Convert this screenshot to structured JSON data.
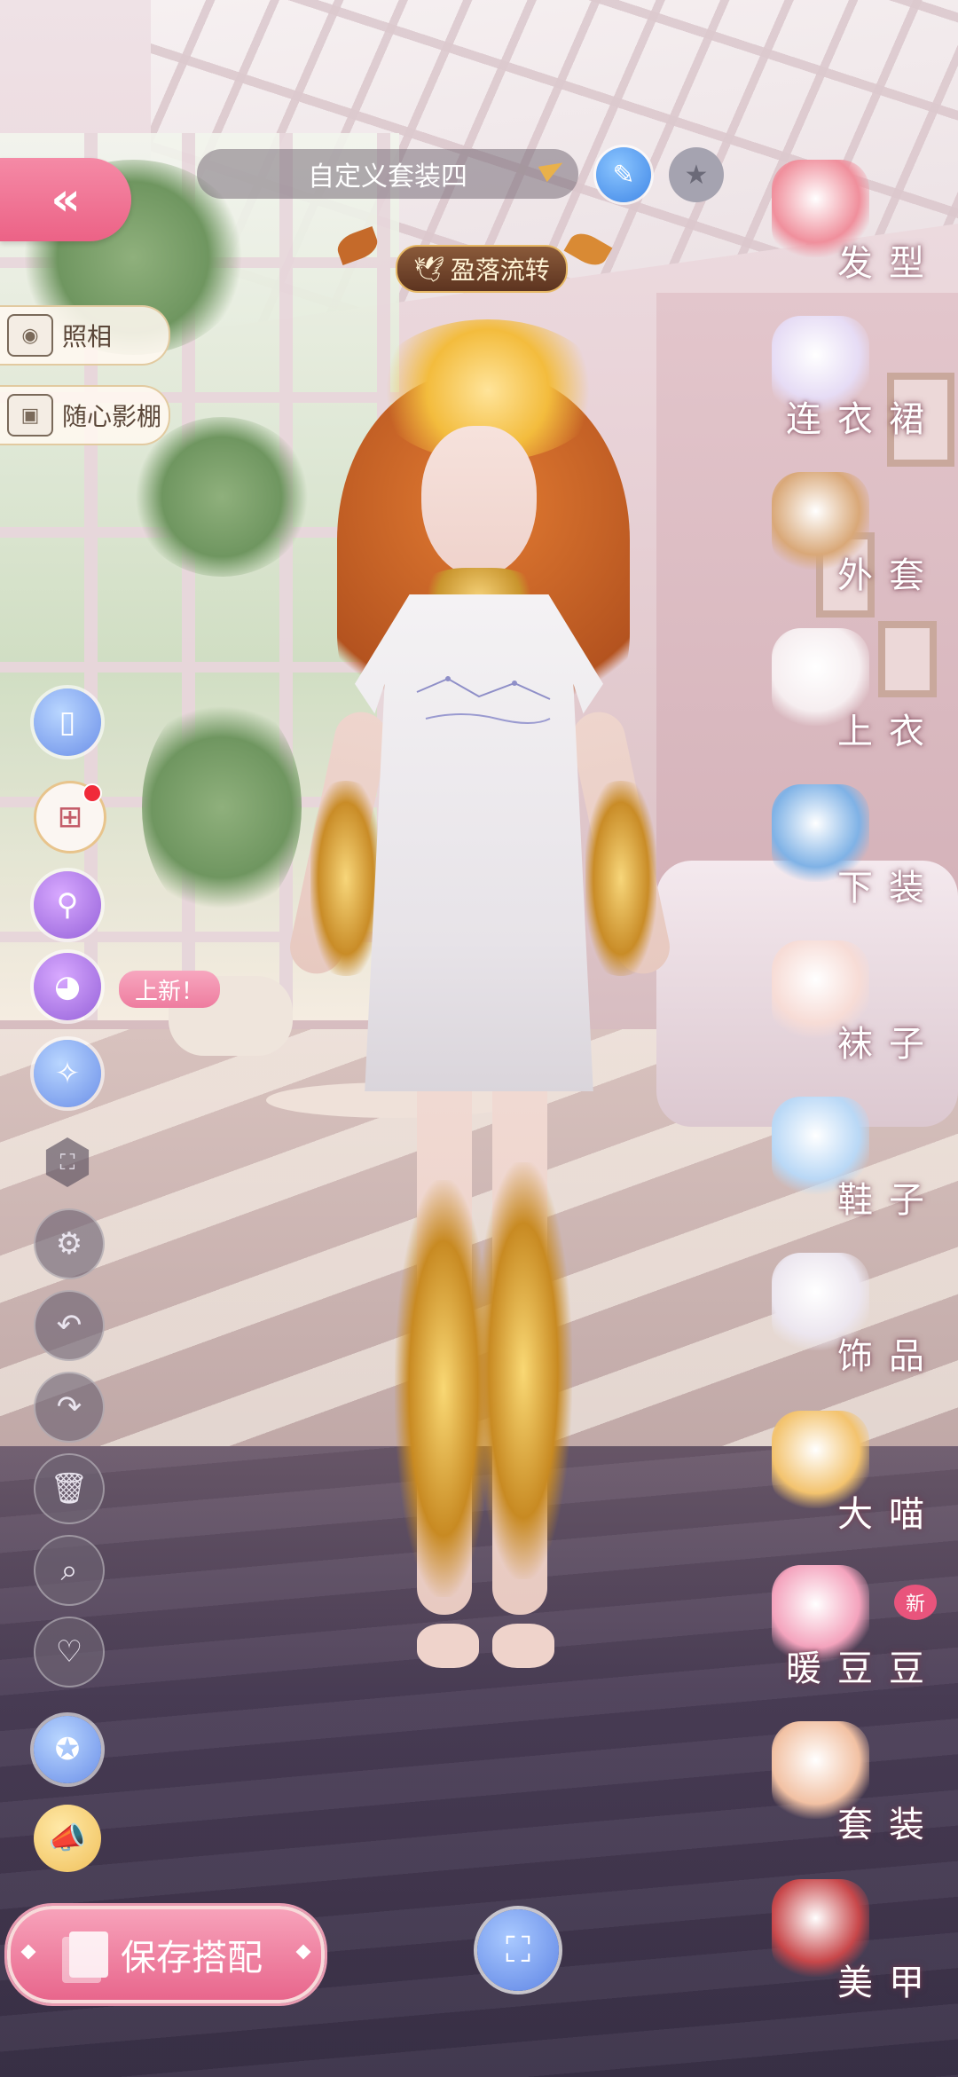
{
  "header": {
    "outfit_name": "自定义套装四",
    "set_badge": "盈落流转"
  },
  "left_menu": {
    "photo_label": "照相",
    "studio_label": "随心影棚",
    "new_tag": "上新！"
  },
  "bottom": {
    "save_label": "保存搭配"
  },
  "categories": [
    {
      "label": "发型",
      "icon": "hairstyle-icon",
      "color": "#f08f9c"
    },
    {
      "label": "连衣裙",
      "icon": "dress-icon",
      "color": "#e6dcf5"
    },
    {
      "label": "外套",
      "icon": "coat-icon",
      "color": "#d9a878"
    },
    {
      "label": "上衣",
      "icon": "top-icon",
      "color": "#f6eef0"
    },
    {
      "label": "下装",
      "icon": "bottoms-icon",
      "color": "#7fb2e6"
    },
    {
      "label": "袜子",
      "icon": "socks-icon",
      "color": "#f7dcd6"
    },
    {
      "label": "鞋子",
      "icon": "shoes-icon",
      "color": "#b9d8f6"
    },
    {
      "label": "饰品",
      "icon": "accessory-icon",
      "color": "#ece6ef"
    },
    {
      "label": "大喵",
      "icon": "cat-icon",
      "color": "#f3c36e"
    },
    {
      "label": "暖豆豆",
      "icon": "doll-icon",
      "color": "#f4a3bd",
      "badge": "新"
    },
    {
      "label": "套装",
      "icon": "suit-icon",
      "color": "#f2c1a3"
    },
    {
      "label": "美甲",
      "icon": "nail-polish-icon",
      "color": "#c8474a"
    }
  ],
  "colors": {
    "accent_pink": "#ec6286",
    "accent_blue": "#3f86e6",
    "badge_brown": "#5d3420"
  }
}
